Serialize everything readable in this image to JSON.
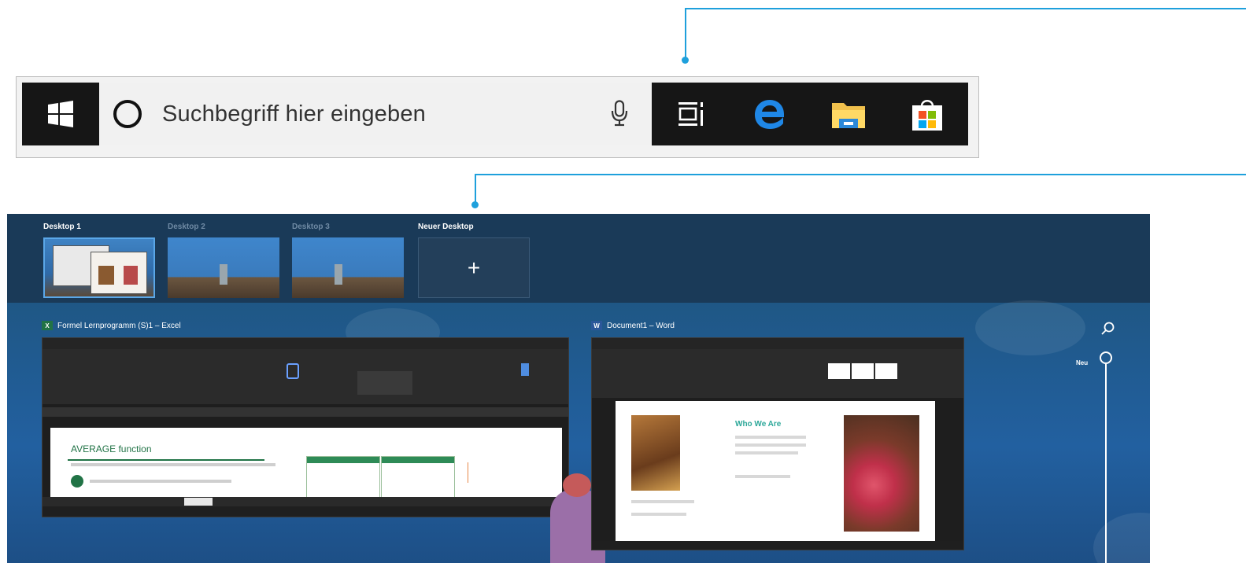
{
  "taskbar": {
    "search_placeholder": "Suchbegriff hier eingeben",
    "icons": [
      "windows-start-icon",
      "cortana-icon",
      "microphone-icon",
      "task-view-icon",
      "edge-icon",
      "file-explorer-icon",
      "store-icon"
    ]
  },
  "task_view": {
    "desktops": [
      {
        "label": "Desktop 1"
      },
      {
        "label": "Desktop 2"
      },
      {
        "label": "Desktop 3"
      }
    ],
    "new_desktop_label": "Neuer Desktop",
    "new_desktop_symbol": "+",
    "windows": [
      {
        "app": "Excel",
        "title": "Formel Lernprogramm (S)1 – Excel",
        "heading": "AVERAGE function"
      },
      {
        "app": "Word",
        "title": "Document1 – Word",
        "heading": "Who We Are"
      }
    ],
    "timeline_label": "Neu"
  },
  "colors": {
    "accent": "#1ea0dc",
    "taskbar": "#161616",
    "search_bg": "#f1f1f1",
    "excel_green": "#217346",
    "word_blue": "#2b579a"
  }
}
